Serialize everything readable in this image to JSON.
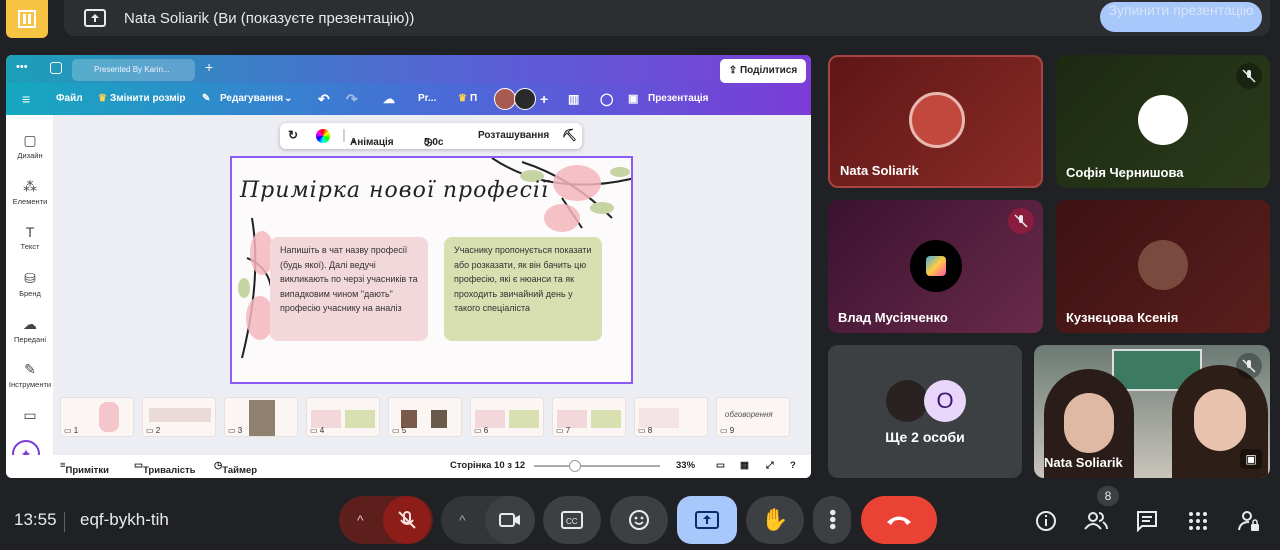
{
  "presenting_bar": {
    "title": "Nata Soliarik (Ви (показуєте презентацію))",
    "stop_label": "Зупинити презентацію"
  },
  "canva": {
    "tab_title": "Presented By Karin...",
    "menu": {
      "file": "Файл",
      "resize": "Змінити розмір",
      "editing": "Редагування",
      "project": "Pr...",
      "project2": "П",
      "present": "Презентація",
      "share": "Поділитися"
    },
    "rail": [
      "Дизайн",
      "Елементи",
      "Текст",
      "Бренд",
      "Передані",
      "Інструменти"
    ],
    "context_toolbar": {
      "animation": "Анімація",
      "duration": "5.0с",
      "position": "Розташування"
    },
    "slide": {
      "title": "Примірка нової професії",
      "card_left": "Напишіть в чат назву професії (будь якої). Далі ведучі викликають по черзі учасників та випадковим чином \"дають\" професію учаснику на аналіз",
      "card_right": "Учаснику пропонується показати або розказати, як він бачить цю професію, які є нюанси та як проходить звичайний день у такого спеціаліста"
    },
    "thumbnails": [
      "1",
      "2",
      "3",
      "4",
      "5",
      "6",
      "7",
      "8",
      "9"
    ],
    "last_thumb_text": "обговорення",
    "footer": {
      "notes": "Примітки",
      "duration": "Тривалість",
      "timer": "Таймер",
      "page": "Сторінка 10 з 12",
      "zoom": "33%"
    }
  },
  "participants": [
    {
      "name": "Nata Soliarik",
      "muted": false
    },
    {
      "name": "Софія Чернишова",
      "muted": true
    },
    {
      "name": "Влад Мусіяченко",
      "muted": true
    },
    {
      "name": "Кузнєцова Ксенія",
      "muted": false
    },
    {
      "name": "Ще 2 особи",
      "initial": "O"
    },
    {
      "name": "Nata Soliarik",
      "muted": true,
      "camera": true
    }
  ],
  "bottom": {
    "time": "13:55",
    "meeting_code": "eqf-bykh-tih",
    "people_count": "8"
  },
  "colors": {
    "end_call": "#ea4335",
    "present_active": "#a8c7fa",
    "mic_off": "#5c1f1b",
    "canva_purple": "#7c3bd7"
  }
}
